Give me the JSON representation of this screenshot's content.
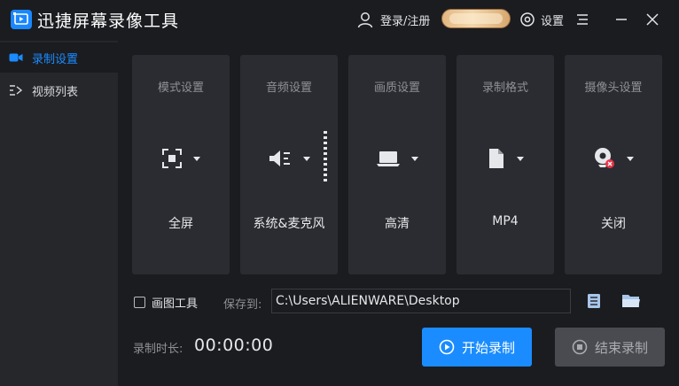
{
  "app": {
    "title": "迅捷屏幕录像工具"
  },
  "header": {
    "login_label": "登录/注册",
    "settings_label": "设置"
  },
  "sidebar": {
    "items": [
      {
        "label": "录制设置",
        "icon": "camera-icon",
        "active": true
      },
      {
        "label": "视频列表",
        "icon": "list-icon",
        "active": false
      }
    ]
  },
  "cards": [
    {
      "title": "模式设置",
      "value": "全屏",
      "icon": "fullscreen-icon"
    },
    {
      "title": "音频设置",
      "value": "系统&麦克风",
      "icon": "speaker-icon"
    },
    {
      "title": "画质设置",
      "value": "高清",
      "icon": "laptop-icon"
    },
    {
      "title": "录制格式",
      "value": "MP4",
      "icon": "file-icon"
    },
    {
      "title": "摄像头设置",
      "value": "关闭",
      "icon": "webcam-off-icon"
    }
  ],
  "tools": {
    "drawing_label": "画图工具",
    "drawing_checked": false
  },
  "save": {
    "label": "保存到:",
    "path": "C:\\Users\\ALIENWARE\\Desktop"
  },
  "duration": {
    "label": "录制时长:",
    "value": "00:00:00"
  },
  "actions": {
    "start_label": "开始录制",
    "stop_label": "结束录制"
  },
  "colors": {
    "accent": "#1a8cff",
    "background": "#1b1c20",
    "panel": "#2b2c31",
    "sidebar": "#26272b"
  }
}
